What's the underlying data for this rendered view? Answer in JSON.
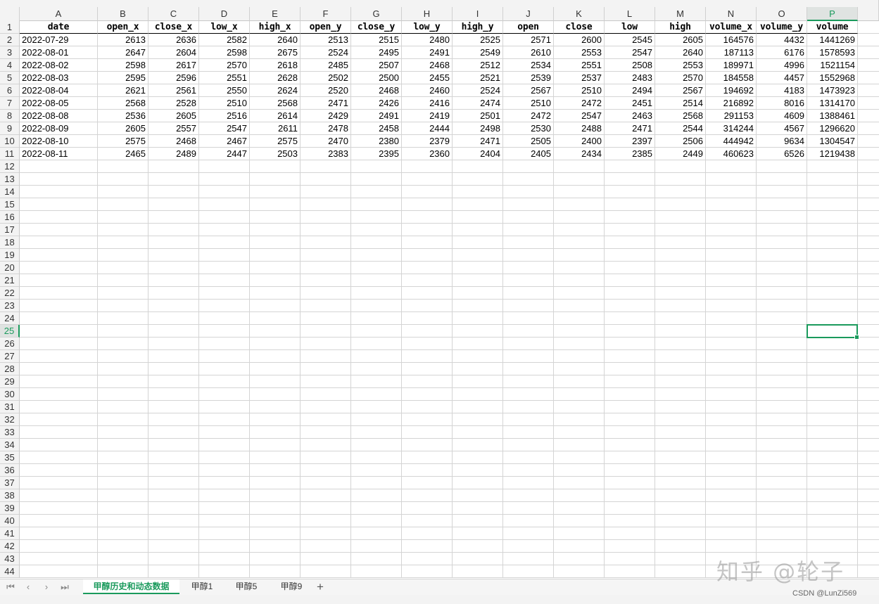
{
  "sheet": {
    "columns": [
      "A",
      "B",
      "C",
      "D",
      "E",
      "F",
      "G",
      "H",
      "I",
      "J",
      "K",
      "L",
      "M",
      "N",
      "O",
      "P"
    ],
    "selected_column": "P",
    "selected_row": 25,
    "row_count": 44,
    "headers": [
      "date",
      "open_x",
      "close_x",
      "low_x",
      "high_x",
      "open_y",
      "close_y",
      "low_y",
      "high_y",
      "open",
      "close",
      "low",
      "high",
      "volume_x",
      "volume_y",
      "volume"
    ],
    "rows": [
      [
        "2022-07-29",
        "2613",
        "2636",
        "2582",
        "2640",
        "2513",
        "2515",
        "2480",
        "2525",
        "2571",
        "2600",
        "2545",
        "2605",
        "164576",
        "4432",
        "1441269"
      ],
      [
        "2022-08-01",
        "2647",
        "2604",
        "2598",
        "2675",
        "2524",
        "2495",
        "2491",
        "2549",
        "2610",
        "2553",
        "2547",
        "2640",
        "187113",
        "6176",
        "1578593"
      ],
      [
        "2022-08-02",
        "2598",
        "2617",
        "2570",
        "2618",
        "2485",
        "2507",
        "2468",
        "2512",
        "2534",
        "2551",
        "2508",
        "2553",
        "189971",
        "4996",
        "1521154"
      ],
      [
        "2022-08-03",
        "2595",
        "2596",
        "2551",
        "2628",
        "2502",
        "2500",
        "2455",
        "2521",
        "2539",
        "2537",
        "2483",
        "2570",
        "184558",
        "4457",
        "1552968"
      ],
      [
        "2022-08-04",
        "2621",
        "2561",
        "2550",
        "2624",
        "2520",
        "2468",
        "2460",
        "2524",
        "2567",
        "2510",
        "2494",
        "2567",
        "194692",
        "4183",
        "1473923"
      ],
      [
        "2022-08-05",
        "2568",
        "2528",
        "2510",
        "2568",
        "2471",
        "2426",
        "2416",
        "2474",
        "2510",
        "2472",
        "2451",
        "2514",
        "216892",
        "8016",
        "1314170"
      ],
      [
        "2022-08-08",
        "2536",
        "2605",
        "2516",
        "2614",
        "2429",
        "2491",
        "2419",
        "2501",
        "2472",
        "2547",
        "2463",
        "2568",
        "291153",
        "4609",
        "1388461"
      ],
      [
        "2022-08-09",
        "2605",
        "2557",
        "2547",
        "2611",
        "2478",
        "2458",
        "2444",
        "2498",
        "2530",
        "2488",
        "2471",
        "2544",
        "314244",
        "4567",
        "1296620"
      ],
      [
        "2022-08-10",
        "2575",
        "2468",
        "2467",
        "2575",
        "2470",
        "2380",
        "2379",
        "2471",
        "2505",
        "2400",
        "2397",
        "2506",
        "444942",
        "9634",
        "1304547"
      ],
      [
        "2022-08-11",
        "2465",
        "2489",
        "2447",
        "2503",
        "2383",
        "2395",
        "2360",
        "2404",
        "2405",
        "2434",
        "2385",
        "2449",
        "460623",
        "6526",
        "1219438"
      ]
    ]
  },
  "tabs": [
    {
      "label": "甲醇历史和动态数据",
      "active": true
    },
    {
      "label": "甲醇1",
      "active": false
    },
    {
      "label": "甲醇5",
      "active": false
    },
    {
      "label": "甲醇9",
      "active": false
    }
  ],
  "nav": {
    "first": "⏮",
    "prev": "‹",
    "next": "›",
    "last": "⏭",
    "add": "+"
  },
  "watermark": "知乎 @轮子",
  "credit": "CSDN @LunZi569",
  "icons": [
    "sheet-nav-first-icon",
    "sheet-nav-prev-icon",
    "sheet-nav-next-icon",
    "sheet-nav-last-icon",
    "add-sheet-icon"
  ]
}
